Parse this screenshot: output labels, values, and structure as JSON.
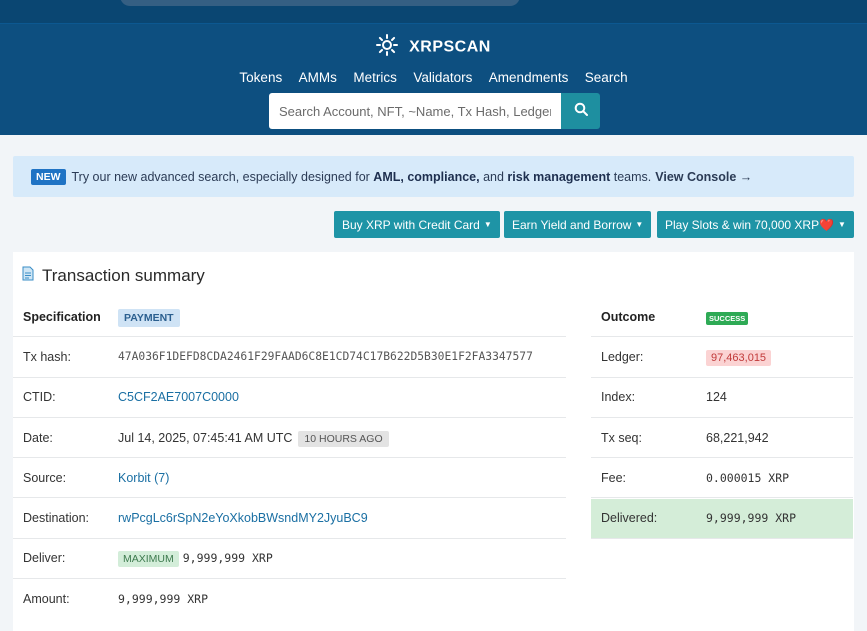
{
  "header": {
    "logo_text": "XRPSCAN",
    "nav": [
      "Tokens",
      "AMMs",
      "Metrics",
      "Validators",
      "Amendments",
      "Search"
    ],
    "search_placeholder": "Search Account, NFT, ~Name, Tx Hash, Ledger"
  },
  "banner": {
    "badge": "NEW",
    "text_1": "Try our new advanced search, especially designed for",
    "aml": "AML,",
    "compliance": "compliance,",
    "and": "and",
    "risk": "risk management",
    "teams": "teams.",
    "cta": "View Console →"
  },
  "actions": {
    "buy": "Buy XRP with Credit Card",
    "earn": "Earn Yield and Borrow",
    "slots": "Play Slots & win 70,000 XRP❤️"
  },
  "summary": {
    "title": "Transaction summary",
    "specification_label": "Specification",
    "specification_value": "PAYMENT",
    "tx_hash_label": "Tx hash:",
    "tx_hash": "47A036F1DEFD8CDA2461F29FAAD6C8E1CD74C17B622D5B30E1F2FA3347577",
    "ctid_label": "CTID:",
    "ctid": "C5CF2AE7007C0000",
    "date_label": "Date:",
    "date": "Jul 14, 2025, 07:45:41 AM UTC",
    "date_ago": "10 HOURS AGO",
    "source_label": "Source:",
    "source": "Korbit (7)",
    "destination_label": "Destination:",
    "destination": "rwPcgLc6rSpN2eYoXkobBWsndMY2JyuBC9",
    "deliver_label": "Deliver:",
    "deliver_badge": "MAXIMUM",
    "deliver_value": "9,999,999 XRP",
    "amount_label": "Amount:",
    "amount": "9,999,999 XRP"
  },
  "outcome": {
    "outcome_label": "Outcome",
    "status": "SUCCESS",
    "ledger_label": "Ledger:",
    "ledger": "97,463,015",
    "index_label": "Index:",
    "index": "124",
    "txseq_label": "Tx seq:",
    "txseq": "68,221,942",
    "fee_label": "Fee:",
    "fee": "0.000015 XRP",
    "delivered_label": "Delivered:",
    "delivered": "9,999,999 XRP"
  }
}
